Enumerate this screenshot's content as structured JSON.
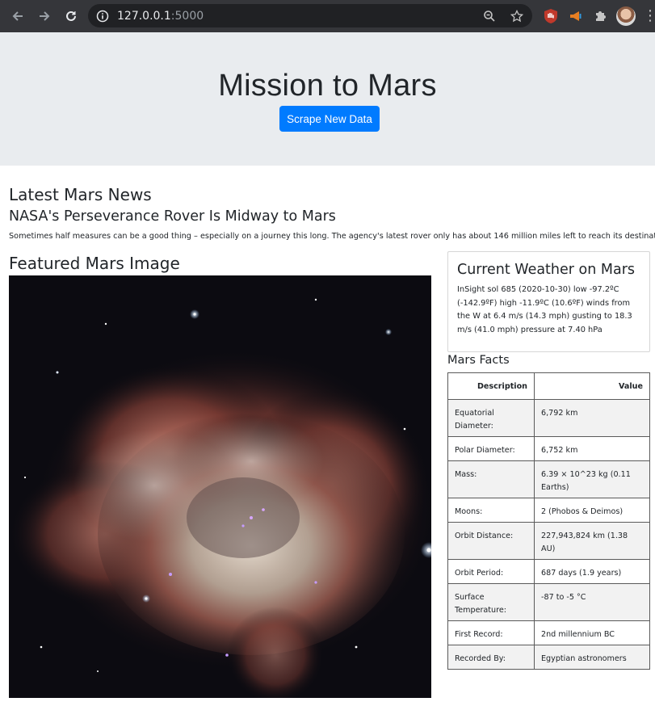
{
  "browser": {
    "url_host": "127.0.0.1",
    "url_port": ":5000"
  },
  "jumbotron": {
    "title": "Mission to Mars",
    "button_label": "Scrape New Data"
  },
  "news": {
    "heading": "Latest Mars News",
    "title": "NASA's Perseverance Rover Is Midway to Mars",
    "paragraph": "Sometimes half measures can be a good thing – especially on a journey this long. The agency's latest rover only has about 146 million miles left to reach its destination."
  },
  "featured": {
    "heading": "Featured Mars Image"
  },
  "weather": {
    "heading": "Current Weather on Mars",
    "text": "InSight sol 685 (2020-10-30) low -97.2ºC (-142.9ºF) high -11.9ºC (10.6ºF) winds from the W at 6.4 m/s (14.3 mph) gusting to 18.3 m/s (41.0 mph) pressure at 7.40 hPa"
  },
  "facts": {
    "heading": "Mars Facts",
    "columns": [
      "Description",
      "Value"
    ],
    "rows": [
      [
        "Equatorial Diameter:",
        "6,792 km"
      ],
      [
        "Polar Diameter:",
        "6,752 km"
      ],
      [
        "Mass:",
        "6.39 × 10^23 kg (0.11 Earths)"
      ],
      [
        "Moons:",
        "2 (Phobos & Deimos)"
      ],
      [
        "Orbit Distance:",
        "227,943,824 km (1.38 AU)"
      ],
      [
        "Orbit Period:",
        "687 days (1.9 years)"
      ],
      [
        "Surface Temperature:",
        "-87 to -5 °C"
      ],
      [
        "First Record:",
        "2nd millennium BC"
      ],
      [
        "Recorded By:",
        "Egyptian astronomers"
      ]
    ]
  },
  "colors": {
    "primary_button": "#007bff",
    "jumbotron_bg": "#e9ecef",
    "chrome_bg": "#35363a"
  }
}
